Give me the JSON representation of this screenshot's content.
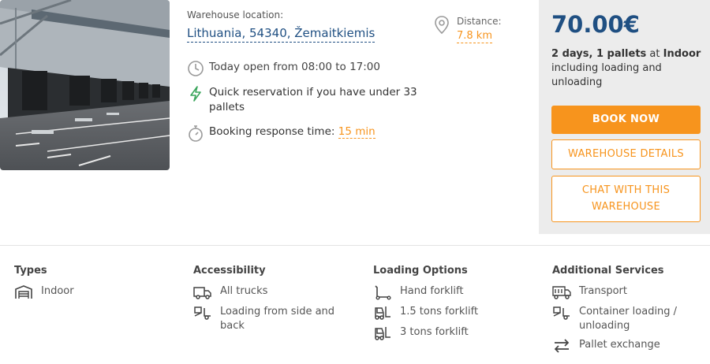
{
  "location": {
    "label": "Warehouse location:",
    "value": "Lithuania, 54340, Žemaitkiemis"
  },
  "distance": {
    "label": "Distance:",
    "value": "7.8 km"
  },
  "features": {
    "hours": "Today open from 08:00 to 17:00",
    "quick": "Quick reservation if you have under 33 pallets",
    "response_label": "Booking response time:",
    "response_value": "15 min"
  },
  "price": {
    "amount": "70.00€",
    "days": "2 days",
    "sep1": ", ",
    "pallets": "1 pallets",
    "at": " at ",
    "type": "Indoor",
    "rest": "including loading and unloading"
  },
  "buttons": {
    "book": "BOOK NOW",
    "details": "WAREHOUSE DETAILS",
    "chat": "CHAT WITH THIS WAREHOUSE"
  },
  "sections": {
    "types": {
      "title": "Types",
      "items": [
        "Indoor"
      ]
    },
    "accessibility": {
      "title": "Accessibility",
      "items": [
        "All trucks",
        "Loading from side and back"
      ]
    },
    "loading": {
      "title": "Loading Options",
      "items": [
        "Hand forklift",
        "1.5 tons forklift",
        "3 tons forklift"
      ]
    },
    "additional": {
      "title": "Additional Services",
      "items": [
        "Transport",
        "Container loading / unloading",
        "Pallet exchange"
      ]
    }
  },
  "colors": {
    "accent": "#f7941d",
    "brand": "#1f4f82",
    "panel": "#ececec"
  },
  "icons": {
    "distance": "map-pin-icon",
    "hours": "clock-icon",
    "quick": "lightning-icon",
    "response": "stopwatch-icon"
  }
}
